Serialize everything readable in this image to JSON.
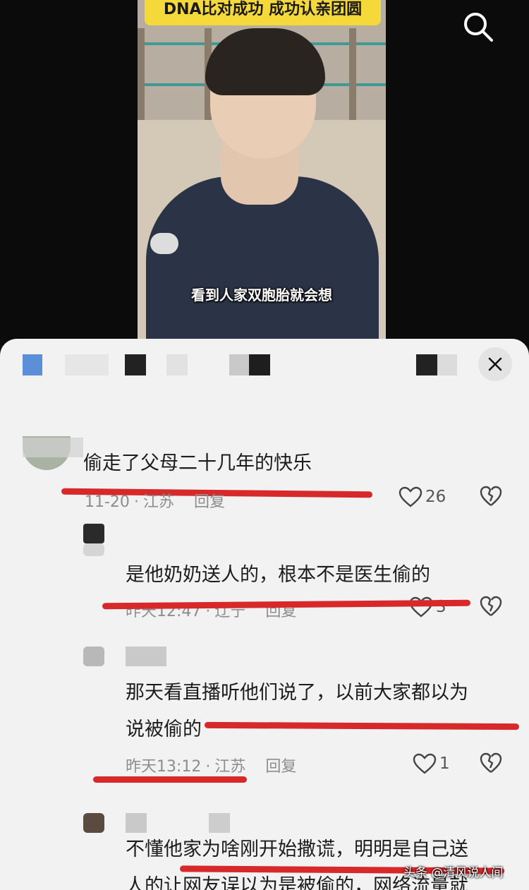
{
  "video": {
    "banner_text": "DNA比对成功 成功认亲团圆",
    "subtitle": "看到人家双胞胎就会想"
  },
  "comments": [
    {
      "text": "偷走了父母二十几年的快乐",
      "date": "11-20",
      "location": "江苏",
      "reply": "回复",
      "likes": "26"
    },
    {
      "text": "是他奶奶送人的，根本不是医生偷的",
      "date": "昨天12:47",
      "location": "辽宁",
      "reply": "回复",
      "likes": "3"
    },
    {
      "text_line1": "那天看直播听他们说了，以前大家都以为",
      "text_line2": "说被偷的",
      "date": "昨天13:12",
      "location": "江苏",
      "reply": "回复",
      "likes": "1"
    },
    {
      "text_line1": "不懂他家为啥刚开始撒谎，明明是自己送",
      "text_line2": "人的让网友误以为是被偷的，网络流量就"
    }
  ],
  "watermark": "头条 @清风说人间",
  "colors": {
    "highlight": "#d7282a",
    "sheet": "#f2f2f2",
    "banner": "#f5d93a"
  }
}
